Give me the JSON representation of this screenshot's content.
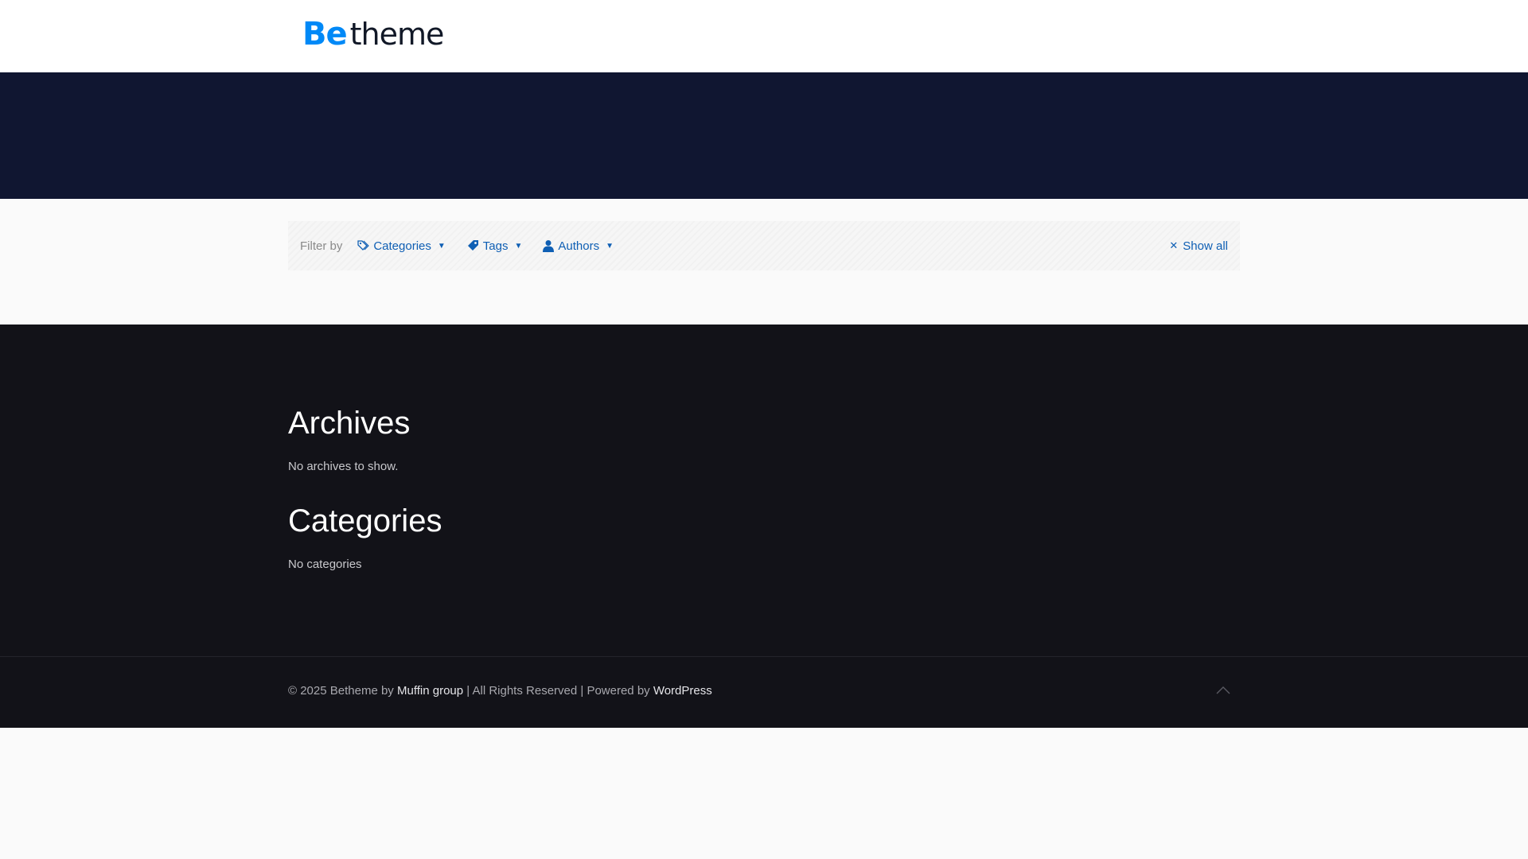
{
  "header": {
    "logo": {
      "be": "Be",
      "theme": "theme"
    }
  },
  "filter": {
    "label": "Filter by",
    "items": [
      {
        "label": "Categories",
        "icon": "tags-icon"
      },
      {
        "label": "Tags",
        "icon": "tag-icon"
      },
      {
        "label": "Authors",
        "icon": "user-icon"
      }
    ],
    "show_all": "Show all"
  },
  "widgets": {
    "archives": {
      "title": "Archives",
      "text": "No archives to show."
    },
    "categories": {
      "title": "Categories",
      "text": "No categories"
    }
  },
  "footer": {
    "prefix": "© 2025 Betheme by ",
    "author_link": "Muffin group",
    "middle": " | All Rights Reserved | Powered by ",
    "platform_link": "WordPress"
  },
  "colors": {
    "accent": "#0089f7",
    "hero_bg": "#101631",
    "footer_bg": "#121218",
    "link": "#0f5fb4"
  }
}
